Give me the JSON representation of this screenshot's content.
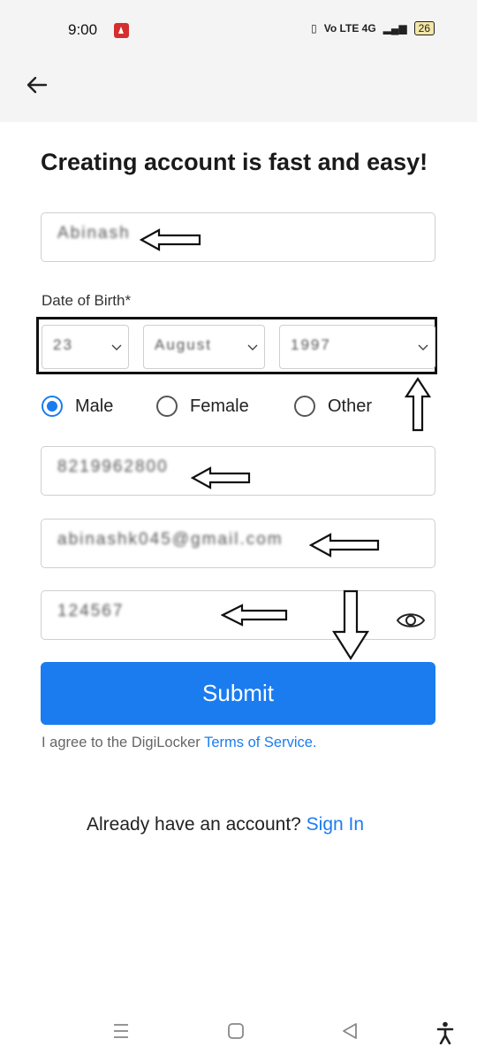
{
  "status_bar": {
    "time": "9:00",
    "signal_text": "Vo LTE 4G",
    "battery": "26"
  },
  "form": {
    "title": "Creating account is fast and easy!",
    "name_value": "Abinash",
    "dob_label": "Date of Birth*",
    "dob_day": "23",
    "dob_month": "August",
    "dob_year": "1997",
    "gender_options": [
      "Male",
      "Female",
      "Other"
    ],
    "gender_selected": "Male",
    "mobile_value": "8219962800",
    "email_value": "abinashk045@gmail.com",
    "password_value": "124567",
    "submit_label": "Submit",
    "agree_prefix": "I agree to the DigiLocker ",
    "terms_link": "Terms of Service.",
    "already_text": "Already have an account? ",
    "signin_link": "Sign In"
  },
  "colors": {
    "accent": "#1b7cf0",
    "header_bg": "#f4f4f4"
  }
}
